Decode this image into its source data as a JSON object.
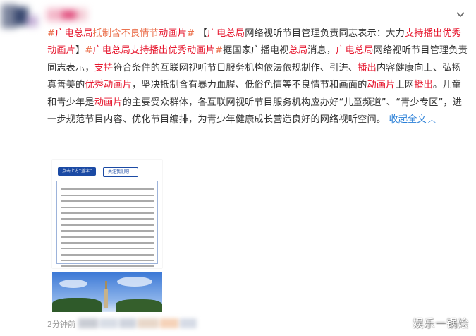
{
  "post": {
    "segments": [
      {
        "t": "#",
        "c": "tag"
      },
      {
        "t": "广电总局",
        "c": "hl"
      },
      {
        "t": "抵制含不良情节",
        "c": "tag"
      },
      {
        "t": "动画片",
        "c": "hl"
      },
      {
        "t": "#",
        "c": "tag"
      },
      {
        "t": " 【",
        "c": ""
      },
      {
        "t": "广电总局",
        "c": "hl"
      },
      {
        "t": "网络视听节目管理负责同志表示：大力",
        "c": ""
      },
      {
        "t": "支持播出优秀动画片",
        "c": "hl"
      },
      {
        "t": "】",
        "c": ""
      },
      {
        "t": "#",
        "c": "tag"
      },
      {
        "t": "广电总局",
        "c": "hl"
      },
      {
        "t": "支持播出优秀动画片",
        "c": "hl"
      },
      {
        "t": "#",
        "c": "tag"
      },
      {
        "t": "据国家广播电视",
        "c": ""
      },
      {
        "t": "总局",
        "c": "hl"
      },
      {
        "t": "消息，",
        "c": ""
      },
      {
        "t": "广电总局",
        "c": "hl"
      },
      {
        "t": "网络视听节目管理负责同志表示，",
        "c": ""
      },
      {
        "t": "支持",
        "c": "hl"
      },
      {
        "t": "符合条件的互联网视听节目服务机构依法依规制作、引进、",
        "c": ""
      },
      {
        "t": "播出",
        "c": "hl"
      },
      {
        "t": "内容健康向上、弘扬真善美的",
        "c": ""
      },
      {
        "t": "优秀动画片",
        "c": "hl"
      },
      {
        "t": "，坚决抵制含有暴力血腥、低俗色情等不良情节和画面的",
        "c": ""
      },
      {
        "t": "动画片",
        "c": "hl"
      },
      {
        "t": "上网",
        "c": ""
      },
      {
        "t": "播出",
        "c": "hl"
      },
      {
        "t": "。儿童和青少年是",
        "c": ""
      },
      {
        "t": "动画片",
        "c": "hl"
      },
      {
        "t": "的主要受众群体，各互联网视听节目服务机构应办好“儿童频道”、“青少专区”，进一步规范节目内容、优化节目编排，为青少年健康成长营造良好的网络视听空间。 ",
        "c": ""
      }
    ],
    "collapse_label": "收起全文",
    "collapse_arrow": "︿"
  },
  "card": {
    "pill_follow": "点击上方“蓝字”",
    "pill_attention": "关注我们吧！"
  },
  "footer": {
    "time": "2分钟前"
  },
  "watermark": "娱乐一锅烩",
  "colors": {
    "highlight": "#e6162d",
    "tag": "#eb7350",
    "link": "#2a7fd7"
  },
  "icons": {
    "menu": "chevron-down-icon"
  }
}
